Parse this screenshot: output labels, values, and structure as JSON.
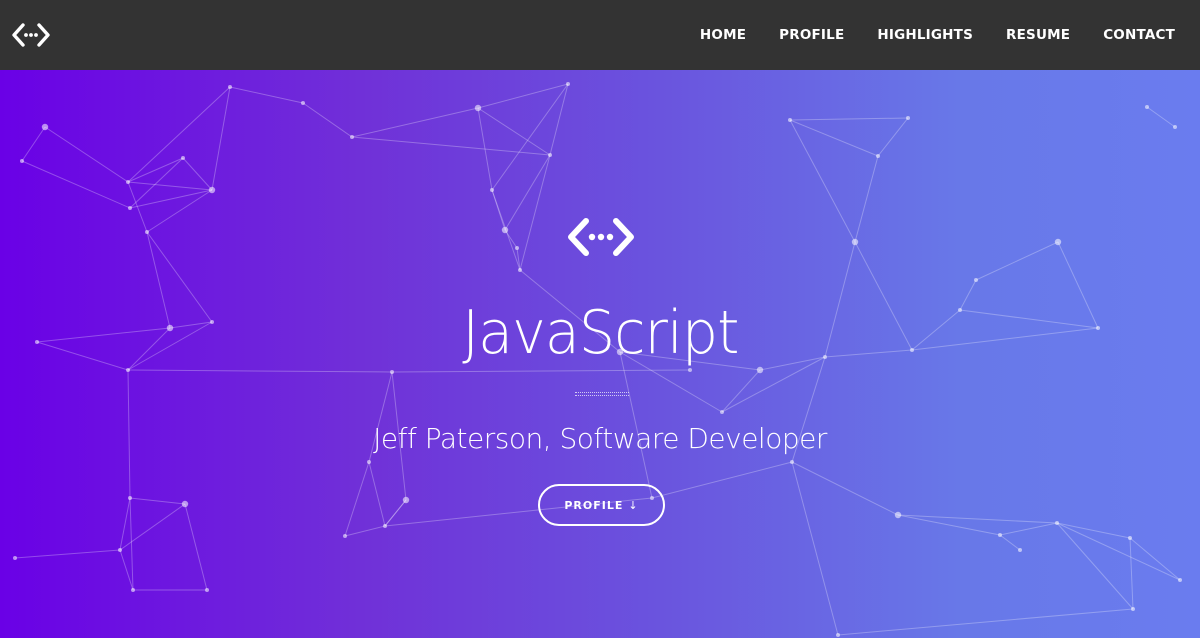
{
  "header": {
    "logo_icon": "code-brackets-icon",
    "nav": [
      {
        "label": "HOME"
      },
      {
        "label": "PROFILE"
      },
      {
        "label": "HIGHLIGHTS"
      },
      {
        "label": "RESUME"
      },
      {
        "label": "CONTACT"
      }
    ]
  },
  "hero": {
    "logo_icon": "code-brackets-icon",
    "title": "JavaScript",
    "subtitle": "Jeff Paterson, Software Developer",
    "button_label": "PROFILE",
    "button_icon": "arrow-down-icon",
    "gradient_colors": [
      "#6a00e6",
      "#6a7cef"
    ]
  },
  "colors": {
    "navbar": "#333333",
    "text": "#ffffff"
  }
}
